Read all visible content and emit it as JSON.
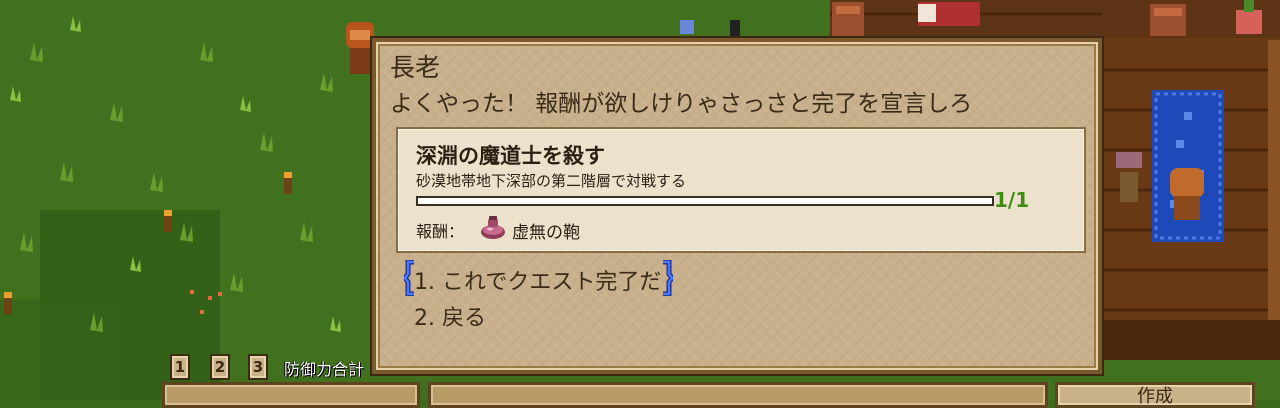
{
  "dialog": {
    "speaker": "長老",
    "text": "よくやった！ 報酬が欲しけりゃさっさと完了を宣言しろ"
  },
  "quest": {
    "title": "深淵の魔道士を殺す",
    "description": "砂漠地帯地下深部の第二階層で対戦する",
    "progress_text": "1/1",
    "progress_fraction": 1.0,
    "reward_label": "報酬：",
    "reward_item": "虚無の鞄",
    "reward_icon": "bag-icon"
  },
  "options": [
    {
      "label": "1. これでクエスト完了だ",
      "selected": true
    },
    {
      "label": "2. 戻る",
      "selected": false
    }
  ],
  "hotbar": {
    "tabs": [
      "1",
      "2",
      "3"
    ],
    "label": "防御力合計"
  },
  "craft_button": "作成",
  "colors": {
    "panel": "#c8b08c",
    "panel_border": "#7a5a2c",
    "quest_card": "#ece2cc",
    "progress_text": "#3f8c12",
    "selection_bracket": "#2a4bd8"
  }
}
